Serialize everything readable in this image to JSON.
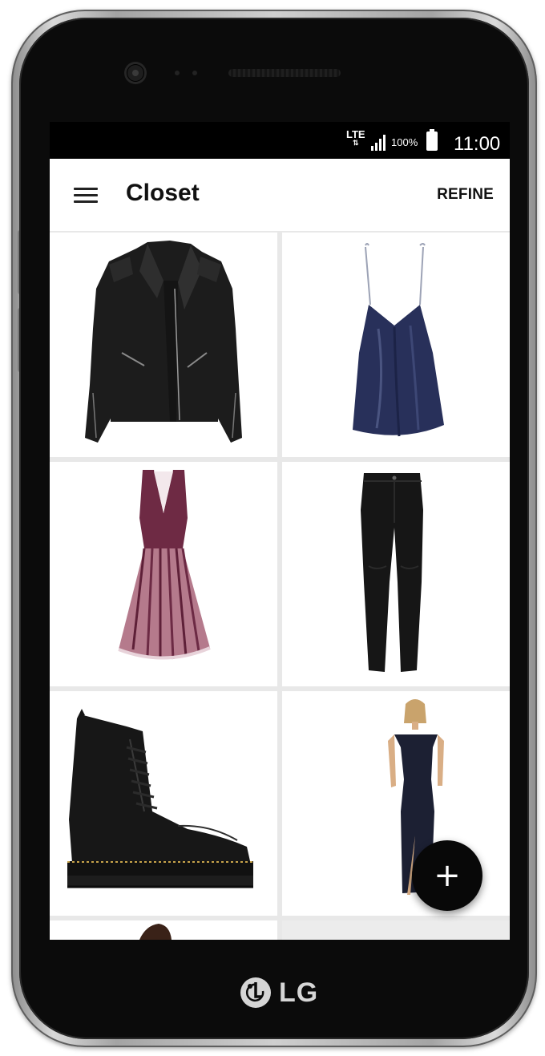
{
  "status_bar": {
    "network": "LTE",
    "battery_percent": "100%",
    "time": "11:00"
  },
  "app_bar": {
    "title": "Closet",
    "refine_label": "REFINE",
    "menu_icon": "hamburger-menu-icon"
  },
  "closet_items": [
    "black leather biker jacket",
    "navy satin camisole",
    "burgundy pleated tulle dress",
    "black skinny jeans",
    "black platform lace-up boots",
    "navy off-shoulder maxi dress"
  ],
  "fab": {
    "label": "+",
    "icon": "add-icon"
  },
  "device": {
    "brand": "LG"
  },
  "colors": {
    "app_background": "#ffffff",
    "status_bar": "#000000",
    "fab": "#080808"
  }
}
